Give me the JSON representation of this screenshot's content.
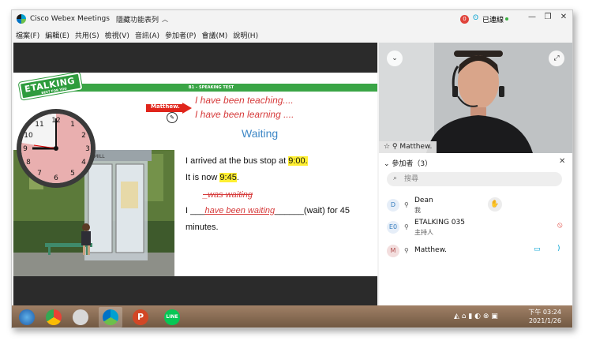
{
  "window": {
    "app_title": "Cisco Webex Meetings",
    "meeting_title": "隱藏功能表列",
    "connection_status": "已連線",
    "record_badge": "0"
  },
  "menu": [
    "檔案(F)",
    "編輯(E)",
    "共用(S)",
    "檢視(V)",
    "音訊(A)",
    "參加者(P)",
    "會議(M)",
    "說明(H)"
  ],
  "slide": {
    "logo_text": "ETALKING",
    "logo_sub": "BEST FOR YOU",
    "header": "B1 – SPEAKING TEST",
    "annotator_name": "Matthew.",
    "handwriting_1": "I have been teaching....",
    "handwriting_2": "I have been learning ....",
    "title": "Waiting",
    "line1_text": "I arrived at the bus stop at ",
    "line1_time": "9:00.",
    "line2_text": "It is now ",
    "line2_time": "9:45",
    "line2_end": ".",
    "struck_answer": "_was waiting",
    "line4_prefix": "I ___",
    "line4_answer": "have been waiting",
    "line4_suffix": "______(wait) for 45",
    "line5_text": "minutes.",
    "sign_text": "MILL"
  },
  "video": {
    "participant_label": "Matthew."
  },
  "participants_panel": {
    "header": "參加者（3）",
    "search_placeholder": "搜尋",
    "list": [
      {
        "initial": "D",
        "name": "Dean",
        "role": "我"
      },
      {
        "initial": "E0",
        "name": "ETALKING 035",
        "role": "主持人"
      },
      {
        "initial": "M",
        "name": "Matthew.",
        "role": ""
      }
    ]
  },
  "taskbar": {
    "time": "下午 03:24",
    "date": "2021/1/26",
    "apps": [
      "start",
      "chrome",
      "network-app",
      "webex",
      "powerpoint",
      "line"
    ],
    "powerpoint_letter": "P",
    "line_label": "LINE"
  },
  "colors": {
    "accent_green": "#3aa546",
    "annotation_red": "#d63b3b",
    "title_blue": "#3d87c6",
    "highlight_yellow": "#ffef33"
  }
}
